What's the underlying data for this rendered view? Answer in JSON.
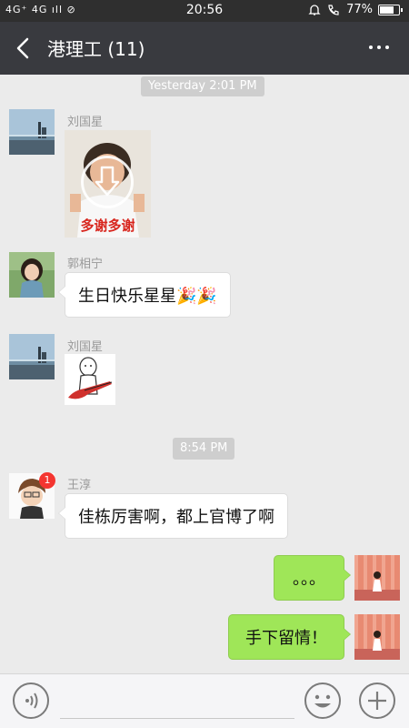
{
  "status_bar": {
    "signal": "4G⁺ 4G ıll ⊘",
    "time": "20:56",
    "battery_text": "77%",
    "battery_level": 0.77
  },
  "header": {
    "title": "港理工 (11)"
  },
  "timestamps": [
    "Yesterday 2:01 PM",
    "8:54 PM"
  ],
  "messages": [
    {
      "sender": "刘国星",
      "type": "image",
      "caption": "多谢多谢"
    },
    {
      "sender": "郭相宁",
      "type": "text",
      "text": "生日快乐星星🎉🎉"
    },
    {
      "sender": "刘国星",
      "type": "sticker"
    },
    {
      "sender": "王淳",
      "type": "text",
      "text": "佳栋厉害啊，都上官博了啊",
      "badge": "1"
    },
    {
      "sender": "me",
      "type": "text",
      "text": "。。。"
    },
    {
      "sender": "me",
      "type": "text",
      "text": "手下留情！"
    }
  ],
  "colors": {
    "status_bar": "#2f2f2f",
    "title_bar": "#393a3f",
    "chat_bg": "#ebebeb",
    "my_bubble": "#9fe658",
    "badge": "#f43530"
  },
  "icons": {
    "back": "back-arrow-icon",
    "more": "more-dots-icon",
    "voice": "voice-icon",
    "emoji": "emoji-icon",
    "add": "plus-icon"
  }
}
